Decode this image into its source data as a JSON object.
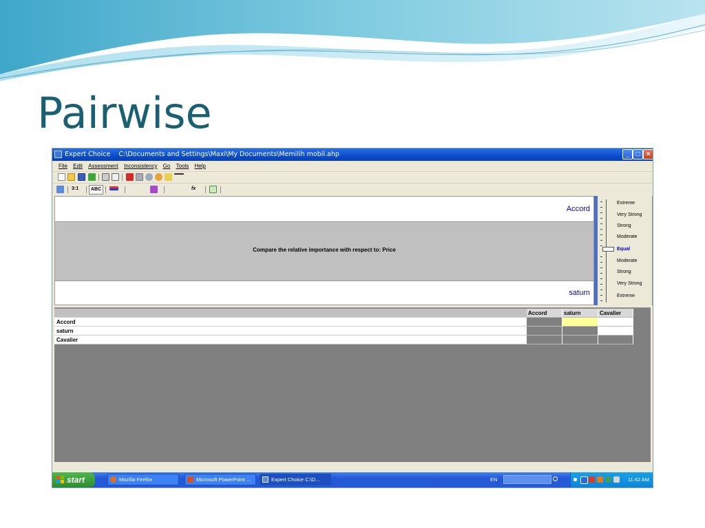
{
  "slide": {
    "title": "Pairwise"
  },
  "window": {
    "app_name": "Expert Choice",
    "path": "C:\\Documents and Settings\\Maxi\\My Documents\\Memilih mobil.ahp",
    "title_separator": "    "
  },
  "menu": [
    "File",
    "Edit",
    "Assessment",
    "Inconsistency",
    "Go",
    "Tools",
    "Help"
  ],
  "toolbar2": {
    "ratio_label": "3:1",
    "abc_label": "ABC",
    "fx_label": "fx"
  },
  "comparison": {
    "top_item": "Accord",
    "bottom_item": "saturn",
    "prompt": "Compare the relative importance with respect to: Price"
  },
  "scale": {
    "labels": [
      "Extreme",
      "Very Strong",
      "Strong",
      "Moderate",
      "Equal",
      "Moderate",
      "Strong",
      "Very Strong",
      "Extreme"
    ],
    "selected": "Equal"
  },
  "matrix": {
    "columns": [
      "Accord",
      "saturn",
      "Cavalier"
    ],
    "rows": [
      "Accord",
      "saturn",
      "Cavalier"
    ],
    "highlight_color": "#ffff99"
  },
  "taskbar": {
    "start_label": "start",
    "buttons": [
      "Mozilla Firefox",
      "Microsoft PowerPoint ...",
      "Expert Choice    C:\\D..."
    ],
    "language": "EN",
    "clock": "11:42 AM"
  },
  "colors": {
    "title_color": "#1b5f73",
    "xp_blue": "#0a4ccc",
    "item_text": "#0000cc"
  }
}
